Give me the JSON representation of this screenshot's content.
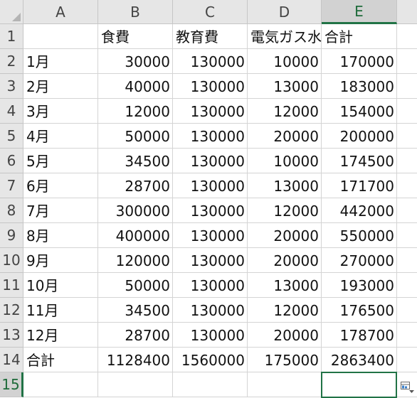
{
  "sheet": {
    "columns": [
      "A",
      "B",
      "C",
      "D",
      "E"
    ],
    "selected_column": "E",
    "selected_row": "15",
    "rows": [
      {
        "num": "1",
        "cells": [
          "",
          "食費",
          "教育費",
          "電気ガス水道",
          "合計"
        ]
      },
      {
        "num": "2",
        "cells": [
          "1月",
          "30000",
          "130000",
          "10000",
          "170000"
        ]
      },
      {
        "num": "3",
        "cells": [
          "2月",
          "40000",
          "130000",
          "13000",
          "183000"
        ]
      },
      {
        "num": "4",
        "cells": [
          "3月",
          "12000",
          "130000",
          "12000",
          "154000"
        ]
      },
      {
        "num": "5",
        "cells": [
          "4月",
          "50000",
          "130000",
          "20000",
          "200000"
        ]
      },
      {
        "num": "6",
        "cells": [
          "5月",
          "34500",
          "130000",
          "10000",
          "174500"
        ]
      },
      {
        "num": "7",
        "cells": [
          "6月",
          "28700",
          "130000",
          "13000",
          "171700"
        ]
      },
      {
        "num": "8",
        "cells": [
          "7月",
          "300000",
          "130000",
          "12000",
          "442000"
        ]
      },
      {
        "num": "9",
        "cells": [
          "8月",
          "400000",
          "130000",
          "20000",
          "550000"
        ]
      },
      {
        "num": "10",
        "cells": [
          "9月",
          "120000",
          "130000",
          "20000",
          "270000"
        ]
      },
      {
        "num": "11",
        "cells": [
          "10月",
          "50000",
          "130000",
          "13000",
          "193000"
        ]
      },
      {
        "num": "12",
        "cells": [
          "11月",
          "34500",
          "130000",
          "12000",
          "176500"
        ]
      },
      {
        "num": "13",
        "cells": [
          "12月",
          "28700",
          "130000",
          "20000",
          "178700"
        ]
      },
      {
        "num": "14",
        "cells": [
          "合計",
          "1128400",
          "1560000",
          "175000",
          "2863400"
        ]
      },
      {
        "num": "15",
        "cells": [
          "",
          "",
          "",
          "",
          ""
        ]
      }
    ]
  },
  "colors": {
    "accent": "#217346",
    "header_bg": "#e6e6e6",
    "grid": "#d4d4d4"
  },
  "icons": {
    "quick_analysis": "quick-analysis-icon"
  }
}
